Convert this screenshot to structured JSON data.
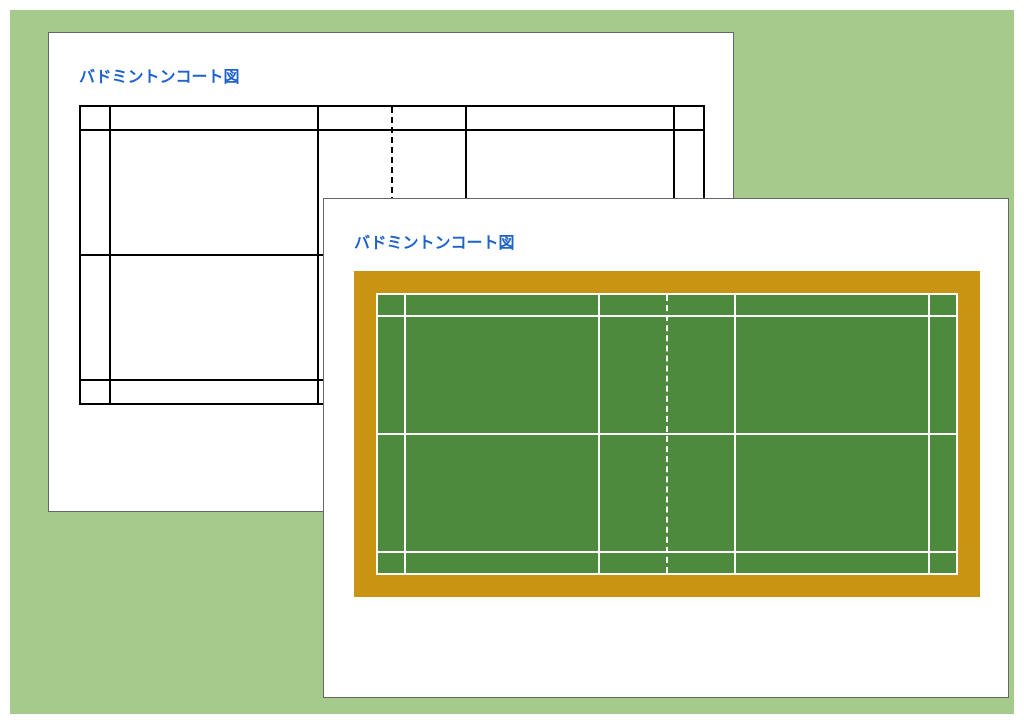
{
  "panels": {
    "a": {
      "title": "バドミントンコート図"
    },
    "b": {
      "title": "バドミントンコート図"
    }
  },
  "chart_data": [
    {
      "type": "diagram",
      "subject": "badminton-court",
      "style": "outline",
      "line_color": "#000000",
      "fill_color": "#ffffff",
      "net": {
        "position": 0.5,
        "style": "dashed"
      },
      "lines": {
        "doubles_sideline": true,
        "singles_sideline": true,
        "center_service_line": true,
        "short_service_line": true,
        "back_boundary": true,
        "long_service_line_doubles": true
      }
    },
    {
      "type": "diagram",
      "subject": "badminton-court",
      "style": "filled",
      "line_color": "#ffffff",
      "court_fill": "#4d8a3d",
      "surround_fill": "#c89411",
      "net": {
        "position": 0.5,
        "style": "dashed"
      },
      "lines": {
        "doubles_sideline": true,
        "singles_sideline": true,
        "center_service_line": true,
        "short_service_line": true,
        "back_boundary": true,
        "long_service_line_doubles": true
      }
    }
  ]
}
